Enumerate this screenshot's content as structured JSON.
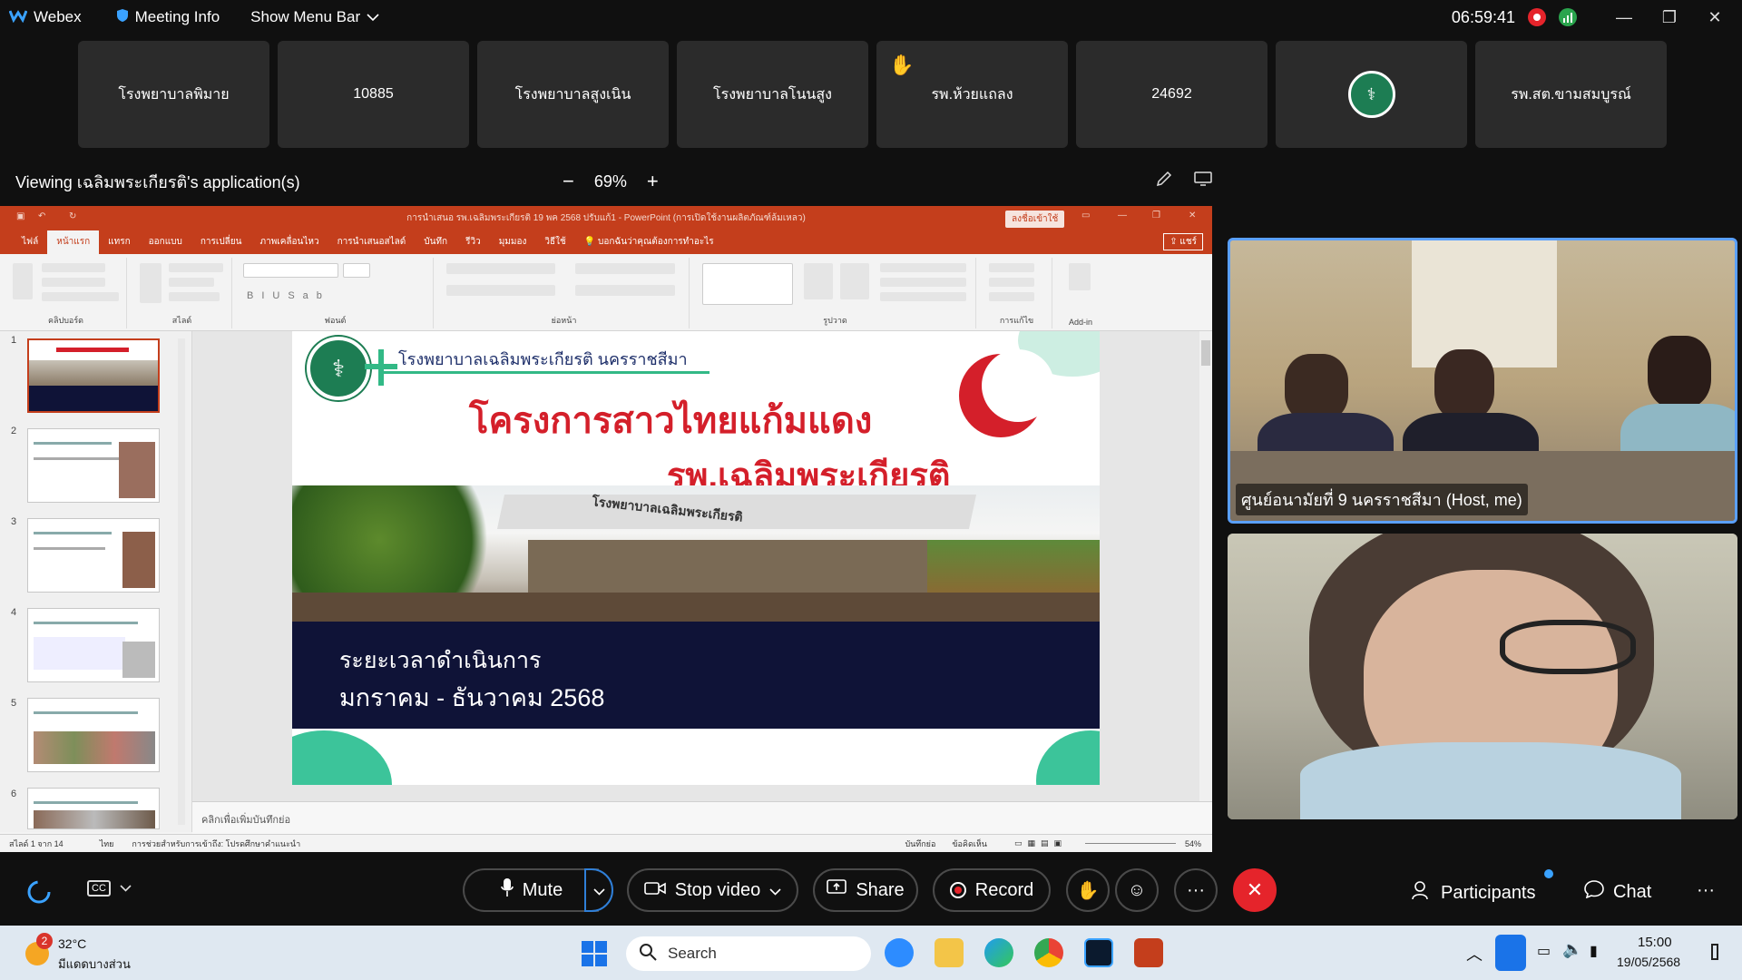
{
  "topbar": {
    "app_name": "Webex",
    "meeting_info": "Meeting Info",
    "show_menu_bar": "Show Menu Bar",
    "clock": "06:59:41"
  },
  "participants_strip": [
    {
      "name": "โรงพยาบาลพิมาย"
    },
    {
      "name": "10885"
    },
    {
      "name": "โรงพยาบาลสูงเนิน"
    },
    {
      "name": "โรงพยาบาลโนนสูง"
    },
    {
      "name": "รพ.ห้วยแถลง",
      "hand_raised": true
    },
    {
      "name": "24692"
    },
    {
      "name": "",
      "logo": true
    },
    {
      "name": "รพ.สต.ขามสมบูรณ์"
    }
  ],
  "viewing": {
    "text": "Viewing เฉลิมพระเกียรติ's application(s)",
    "zoom_minus": "−",
    "zoom_level": "69%",
    "zoom_plus": "+"
  },
  "ppt": {
    "window_title": "การนำเสนอ รพ.เฉลิมพระเกียรติ 19 พค 2568 ปรับแก้1  -  PowerPoint (การเปิดใช้งานผลิตภัณฑ์ล้มเหลว)",
    "signin": "ลงชื่อเข้าใช้",
    "share": "แชร์",
    "tabs": [
      "ไฟล์",
      "หน้าแรก",
      "แทรก",
      "ออกแบบ",
      "การเปลี่ยน",
      "ภาพเคลื่อนไหว",
      "การนำเสนอสไลด์",
      "บันทึก",
      "รีวิว",
      "มุมมอง",
      "วิธีใช้",
      "บอกฉันว่าคุณต้องการทำอะไร"
    ],
    "ribbon_groups": [
      "คลิปบอร์ด",
      "สไลด์",
      "ฟอนต์",
      "ย่อหน้า",
      "รูปวาด",
      "การแก้ไข",
      "Add-in"
    ],
    "slide_numbers": [
      "1",
      "2",
      "3",
      "4",
      "5",
      "6"
    ],
    "notes_placeholder": "คลิกเพื่อเพิ่มบันทึกย่อ",
    "status_slide": "สไลด์ 1 จาก 14",
    "status_lang": "ไทย",
    "status_accessibility": "การช่วยสำหรับการเข้าถึง: โปรดศึกษาคำแนะนำ",
    "status_notes": "บันทึกย่อ",
    "status_comments": "ข้อคิดเห็น",
    "status_zoom": "54%"
  },
  "slide": {
    "hospital_line": "โรงพยาบาลเฉลิมพระเกียรติ นครราชสีมา",
    "title_line1": "โครงการสาวไทยแก้มแดง",
    "title_line2": "รพ.เฉลิมพระเกียรติ",
    "building_sign": "โรงพยาบาลเฉลิมพระเกียรติ",
    "band_line1": "ระยะเวลาดำเนินการ",
    "band_line2": "มกราคม - ธันวาคม 2568"
  },
  "videos": {
    "host_label": "ศูนย์อนามัยที่ 9 นครราชสีมา (Host, me)"
  },
  "controls": {
    "mute": "Mute",
    "stop_video": "Stop video",
    "share": "Share",
    "record": "Record",
    "participants": "Participants",
    "chat": "Chat"
  },
  "taskbar": {
    "temperature": "32°C",
    "weather": "มีแดดบางส่วน",
    "weather_badge": "2",
    "search_placeholder": "Search",
    "time": "15:00",
    "date": "19/05/2568"
  },
  "colors": {
    "ppt_red": "#c43e1c",
    "slide_title_red": "#d41f2a",
    "slide_band_navy": "#0f1337",
    "end_call_red": "#e5242b",
    "active_speaker_blue": "#5aa0ff"
  }
}
